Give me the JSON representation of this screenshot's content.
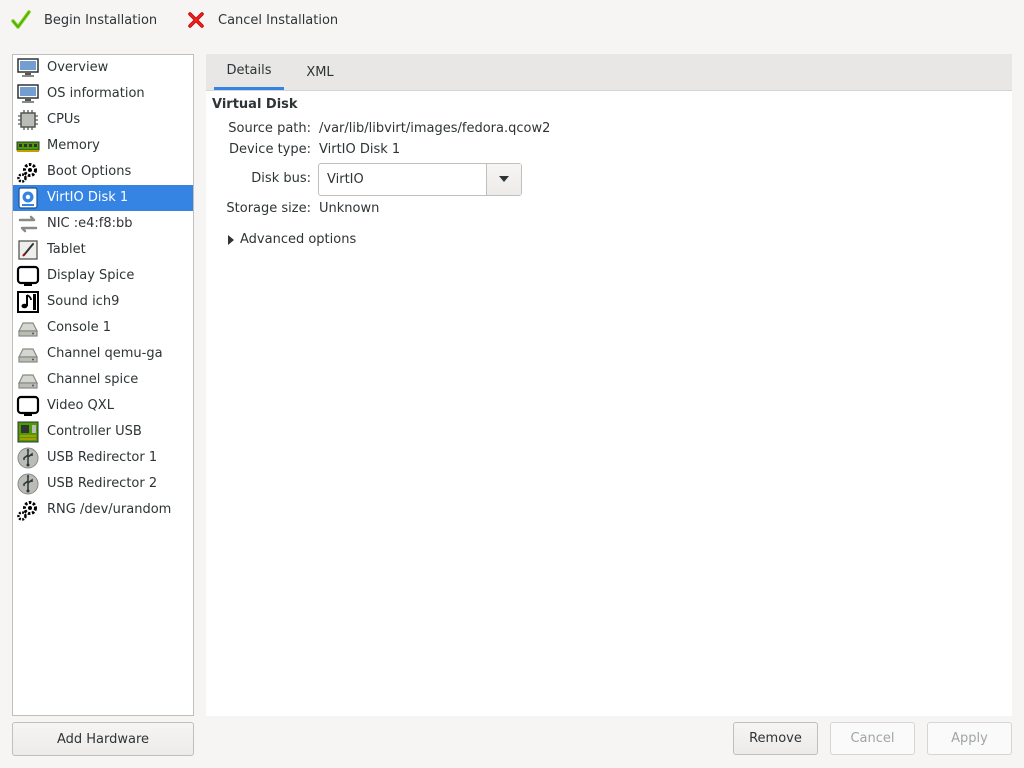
{
  "toolbar": {
    "begin_label": "Begin Installation",
    "cancel_label": "Cancel Installation",
    "begin_icon": "checkmark-icon",
    "cancel_icon": "red-x-icon"
  },
  "sidebar": {
    "selected": "VirtIO Disk 1",
    "items": [
      {
        "label": "Overview",
        "icon": "monitor-icon"
      },
      {
        "label": "OS information",
        "icon": "monitor-icon"
      },
      {
        "label": "CPUs",
        "icon": "cpu-chip-icon"
      },
      {
        "label": "Memory",
        "icon": "memory-stick-icon"
      },
      {
        "label": "Boot Options",
        "icon": "gear-icon"
      },
      {
        "label": "VirtIO Disk 1",
        "icon": "disk-icon"
      },
      {
        "label": "NIC :e4:f8:bb",
        "icon": "network-arrows-icon"
      },
      {
        "label": "Tablet",
        "icon": "tablet-icon"
      },
      {
        "label": "Display Spice",
        "icon": "display-icon"
      },
      {
        "label": "Sound ich9",
        "icon": "sound-icon"
      },
      {
        "label": "Console 1",
        "icon": "serial-device-icon"
      },
      {
        "label": "Channel qemu-ga",
        "icon": "serial-device-icon"
      },
      {
        "label": "Channel spice",
        "icon": "serial-device-icon"
      },
      {
        "label": "Video QXL",
        "icon": "display-icon"
      },
      {
        "label": "Controller USB",
        "icon": "controller-card-icon"
      },
      {
        "label": "USB Redirector 1",
        "icon": "usb-icon"
      },
      {
        "label": "USB Redirector 2",
        "icon": "usb-icon"
      },
      {
        "label": "RNG /dev/urandom",
        "icon": "gear-icon"
      }
    ]
  },
  "add_hardware_label": "Add Hardware",
  "tabs": [
    {
      "label": "Details",
      "active": true
    },
    {
      "label": "XML",
      "active": false
    }
  ],
  "details": {
    "section_title": "Virtual Disk",
    "source_path_label": "Source path:",
    "source_path_value": "/var/lib/libvirt/images/fedora.qcow2",
    "device_type_label": "Device type:",
    "device_type_value": "VirtIO Disk 1",
    "disk_bus_label": "Disk bus:",
    "disk_bus_value": "VirtIO",
    "storage_size_label": "Storage size:",
    "storage_size_value": "Unknown",
    "advanced_label": "Advanced options"
  },
  "buttons": {
    "remove": "Remove",
    "cancel": "Cancel",
    "apply": "Apply"
  },
  "colors": {
    "accent": "#3584e4",
    "check_green": "#73d216",
    "cancel_red": "#cc0000"
  }
}
